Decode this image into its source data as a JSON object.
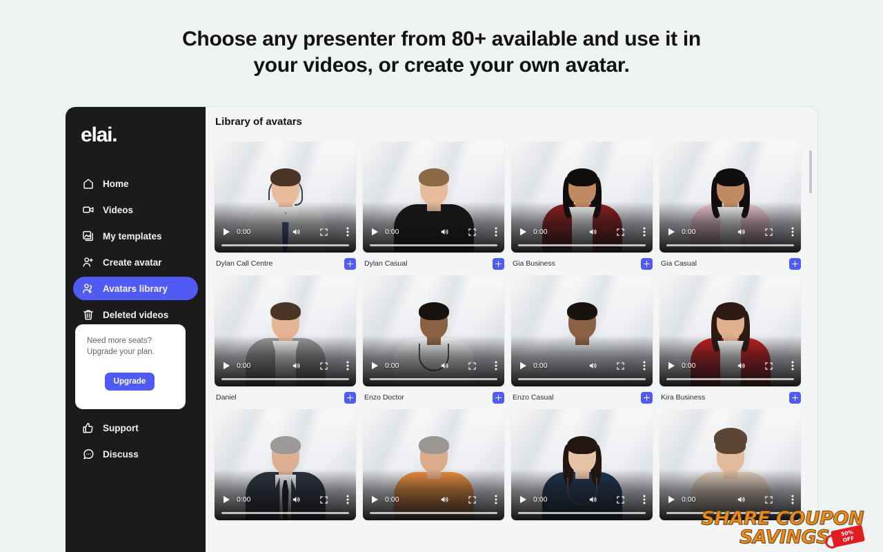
{
  "headline": {
    "line1": "Choose any presenter from 80+ available and use it in",
    "line2": "your videos, or create your own avatar."
  },
  "colors": {
    "page_bg": "#eff2f3",
    "sidebar_bg": "#1b1b1b",
    "accent": "#4f5bf2",
    "panel_bg": "#f3f5f6",
    "watermark_orange": "#f08a1e",
    "watermark_tag_red": "#e31c21"
  },
  "sidebar": {
    "logo": "elai.",
    "items": [
      {
        "label": "Home",
        "icon": "home-icon",
        "active": false
      },
      {
        "label": "Videos",
        "icon": "video-camera-icon",
        "active": false
      },
      {
        "label": "My templates",
        "icon": "image-stack-icon",
        "active": false
      },
      {
        "label": "Create avatar",
        "icon": "user-plus-icon",
        "active": false
      },
      {
        "label": "Avatars library",
        "icon": "users-group-icon",
        "active": true
      },
      {
        "label": "Deleted videos",
        "icon": "trash-icon",
        "active": false
      }
    ],
    "upgrade_card": {
      "line1": "Need more seats?",
      "line2": "Upgrade your plan.",
      "button": "Upgrade"
    },
    "bottom_items": [
      {
        "label": "Support",
        "icon": "thumbs-up-icon"
      },
      {
        "label": "Discuss",
        "icon": "chat-bubble-icon"
      }
    ]
  },
  "main": {
    "title": "Library of avatars",
    "player": {
      "time": "0:00",
      "play_icon": "play-icon",
      "volume_icon": "volume-icon",
      "fullscreen_icon": "fullscreen-icon",
      "more_icon": "kebab-menu-icon",
      "progress_percent": 0
    },
    "add_button_icon": "plus-icon",
    "avatars": [
      {
        "name": "Dylan Call Centre",
        "outfit": "shirt-tie-headset",
        "skin": "#e8bb9a",
        "hair": "#4a3527",
        "hair_long": false,
        "body": "#f0f1f3",
        "accent": "#37588f"
      },
      {
        "name": "Dylan Casual",
        "outfit": "tshirt",
        "skin": "#e8bb9a",
        "hair": "#8a6b46",
        "hair_long": false,
        "body": "#161616",
        "accent": "#161616"
      },
      {
        "name": "Gia Business",
        "outfit": "blazer-collar",
        "skin": "#c08b63",
        "hair": "#110d0c",
        "hair_long": true,
        "body": "#8e1d1d",
        "accent": "#f2f3f5"
      },
      {
        "name": "Gia Casual",
        "outfit": "sweater-collar",
        "skin": "#c08b63",
        "hair": "#120e0d",
        "hair_long": true,
        "body": "#ecc5cf",
        "accent": "#f2f3f5"
      },
      {
        "name": "Daniel",
        "outfit": "sweater-collar",
        "skin": "#e5b493",
        "hair": "#4b3526",
        "hair_long": false,
        "body": "#9a9a9c",
        "accent": "#f2f3f5"
      },
      {
        "name": "Enzo Doctor",
        "outfit": "labcoat-stethoscope",
        "skin": "#8a6243",
        "hair": "#191310",
        "hair_long": false,
        "body": "#f4f5f7",
        "accent": "#4a4e55"
      },
      {
        "name": "Enzo Casual",
        "outfit": "tshirt",
        "skin": "#8a6243",
        "hair": "#191310",
        "hair_long": false,
        "body": "#e4e8ee",
        "accent": "#e4e8ee"
      },
      {
        "name": "Kira Business",
        "outfit": "blazer-collar",
        "skin": "#e0b08f",
        "hair": "#2c1a13",
        "hair_long": true,
        "body": "#c31f22",
        "accent": "#f2f3f5"
      },
      {
        "name": "",
        "outfit": "suit-tie",
        "skin": "#ddb093",
        "hair": "#9c9a98",
        "hair_long": false,
        "body": "#2d3440",
        "accent": "#15181e"
      },
      {
        "name": "",
        "outfit": "tshirt",
        "skin": "#ddab8b",
        "hair": "#9a9693",
        "hair_long": false,
        "body": "#ee9140",
        "accent": "#ee9140"
      },
      {
        "name": "",
        "outfit": "scrubs-stethoscope",
        "skin": "#e7c3a5",
        "hair": "#231510",
        "hair_long": true,
        "body": "#1f3552",
        "accent": "#4a4e55"
      },
      {
        "name": "",
        "outfit": "chef",
        "skin": "#e2bb9c",
        "hair": "#5b4535",
        "hair_long": false,
        "body": "#dfcdb8",
        "accent": "#dfcdb8"
      }
    ]
  },
  "scrollbar": {
    "name": "vertical-scrollbar",
    "thumb_position_percent": 2
  },
  "watermark": {
    "line1": "SHARE COUPON",
    "line2": "SAVINGS",
    "tag_line1": "50%",
    "tag_line2": "OFF"
  }
}
